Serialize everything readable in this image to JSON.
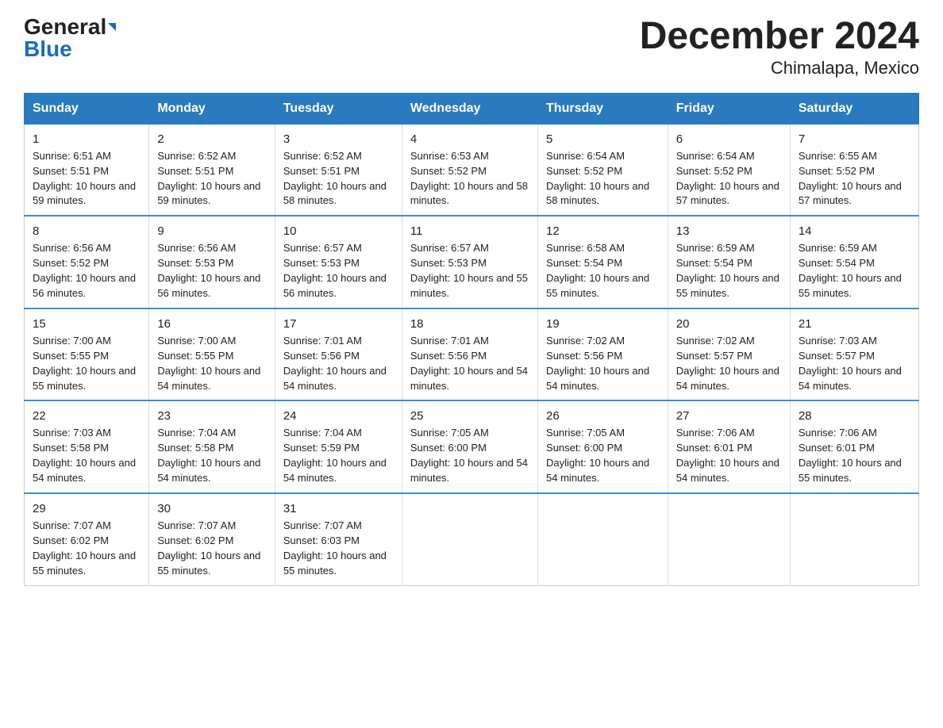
{
  "logo": {
    "general": "General",
    "blue": "Blue"
  },
  "title": "December 2024",
  "subtitle": "Chimalapa, Mexico",
  "weekdays": [
    "Sunday",
    "Monday",
    "Tuesday",
    "Wednesday",
    "Thursday",
    "Friday",
    "Saturday"
  ],
  "weeks": [
    [
      {
        "day": "1",
        "sunrise": "6:51 AM",
        "sunset": "5:51 PM",
        "daylight": "10 hours and 59 minutes."
      },
      {
        "day": "2",
        "sunrise": "6:52 AM",
        "sunset": "5:51 PM",
        "daylight": "10 hours and 59 minutes."
      },
      {
        "day": "3",
        "sunrise": "6:52 AM",
        "sunset": "5:51 PM",
        "daylight": "10 hours and 58 minutes."
      },
      {
        "day": "4",
        "sunrise": "6:53 AM",
        "sunset": "5:52 PM",
        "daylight": "10 hours and 58 minutes."
      },
      {
        "day": "5",
        "sunrise": "6:54 AM",
        "sunset": "5:52 PM",
        "daylight": "10 hours and 58 minutes."
      },
      {
        "day": "6",
        "sunrise": "6:54 AM",
        "sunset": "5:52 PM",
        "daylight": "10 hours and 57 minutes."
      },
      {
        "day": "7",
        "sunrise": "6:55 AM",
        "sunset": "5:52 PM",
        "daylight": "10 hours and 57 minutes."
      }
    ],
    [
      {
        "day": "8",
        "sunrise": "6:56 AM",
        "sunset": "5:52 PM",
        "daylight": "10 hours and 56 minutes."
      },
      {
        "day": "9",
        "sunrise": "6:56 AM",
        "sunset": "5:53 PM",
        "daylight": "10 hours and 56 minutes."
      },
      {
        "day": "10",
        "sunrise": "6:57 AM",
        "sunset": "5:53 PM",
        "daylight": "10 hours and 56 minutes."
      },
      {
        "day": "11",
        "sunrise": "6:57 AM",
        "sunset": "5:53 PM",
        "daylight": "10 hours and 55 minutes."
      },
      {
        "day": "12",
        "sunrise": "6:58 AM",
        "sunset": "5:54 PM",
        "daylight": "10 hours and 55 minutes."
      },
      {
        "day": "13",
        "sunrise": "6:59 AM",
        "sunset": "5:54 PM",
        "daylight": "10 hours and 55 minutes."
      },
      {
        "day": "14",
        "sunrise": "6:59 AM",
        "sunset": "5:54 PM",
        "daylight": "10 hours and 55 minutes."
      }
    ],
    [
      {
        "day": "15",
        "sunrise": "7:00 AM",
        "sunset": "5:55 PM",
        "daylight": "10 hours and 55 minutes."
      },
      {
        "day": "16",
        "sunrise": "7:00 AM",
        "sunset": "5:55 PM",
        "daylight": "10 hours and 54 minutes."
      },
      {
        "day": "17",
        "sunrise": "7:01 AM",
        "sunset": "5:56 PM",
        "daylight": "10 hours and 54 minutes."
      },
      {
        "day": "18",
        "sunrise": "7:01 AM",
        "sunset": "5:56 PM",
        "daylight": "10 hours and 54 minutes."
      },
      {
        "day": "19",
        "sunrise": "7:02 AM",
        "sunset": "5:56 PM",
        "daylight": "10 hours and 54 minutes."
      },
      {
        "day": "20",
        "sunrise": "7:02 AM",
        "sunset": "5:57 PM",
        "daylight": "10 hours and 54 minutes."
      },
      {
        "day": "21",
        "sunrise": "7:03 AM",
        "sunset": "5:57 PM",
        "daylight": "10 hours and 54 minutes."
      }
    ],
    [
      {
        "day": "22",
        "sunrise": "7:03 AM",
        "sunset": "5:58 PM",
        "daylight": "10 hours and 54 minutes."
      },
      {
        "day": "23",
        "sunrise": "7:04 AM",
        "sunset": "5:58 PM",
        "daylight": "10 hours and 54 minutes."
      },
      {
        "day": "24",
        "sunrise": "7:04 AM",
        "sunset": "5:59 PM",
        "daylight": "10 hours and 54 minutes."
      },
      {
        "day": "25",
        "sunrise": "7:05 AM",
        "sunset": "6:00 PM",
        "daylight": "10 hours and 54 minutes."
      },
      {
        "day": "26",
        "sunrise": "7:05 AM",
        "sunset": "6:00 PM",
        "daylight": "10 hours and 54 minutes."
      },
      {
        "day": "27",
        "sunrise": "7:06 AM",
        "sunset": "6:01 PM",
        "daylight": "10 hours and 54 minutes."
      },
      {
        "day": "28",
        "sunrise": "7:06 AM",
        "sunset": "6:01 PM",
        "daylight": "10 hours and 55 minutes."
      }
    ],
    [
      {
        "day": "29",
        "sunrise": "7:07 AM",
        "sunset": "6:02 PM",
        "daylight": "10 hours and 55 minutes."
      },
      {
        "day": "30",
        "sunrise": "7:07 AM",
        "sunset": "6:02 PM",
        "daylight": "10 hours and 55 minutes."
      },
      {
        "day": "31",
        "sunrise": "7:07 AM",
        "sunset": "6:03 PM",
        "daylight": "10 hours and 55 minutes."
      },
      null,
      null,
      null,
      null
    ]
  ],
  "labels": {
    "sunrise": "Sunrise:",
    "sunset": "Sunset:",
    "daylight": "Daylight:"
  }
}
